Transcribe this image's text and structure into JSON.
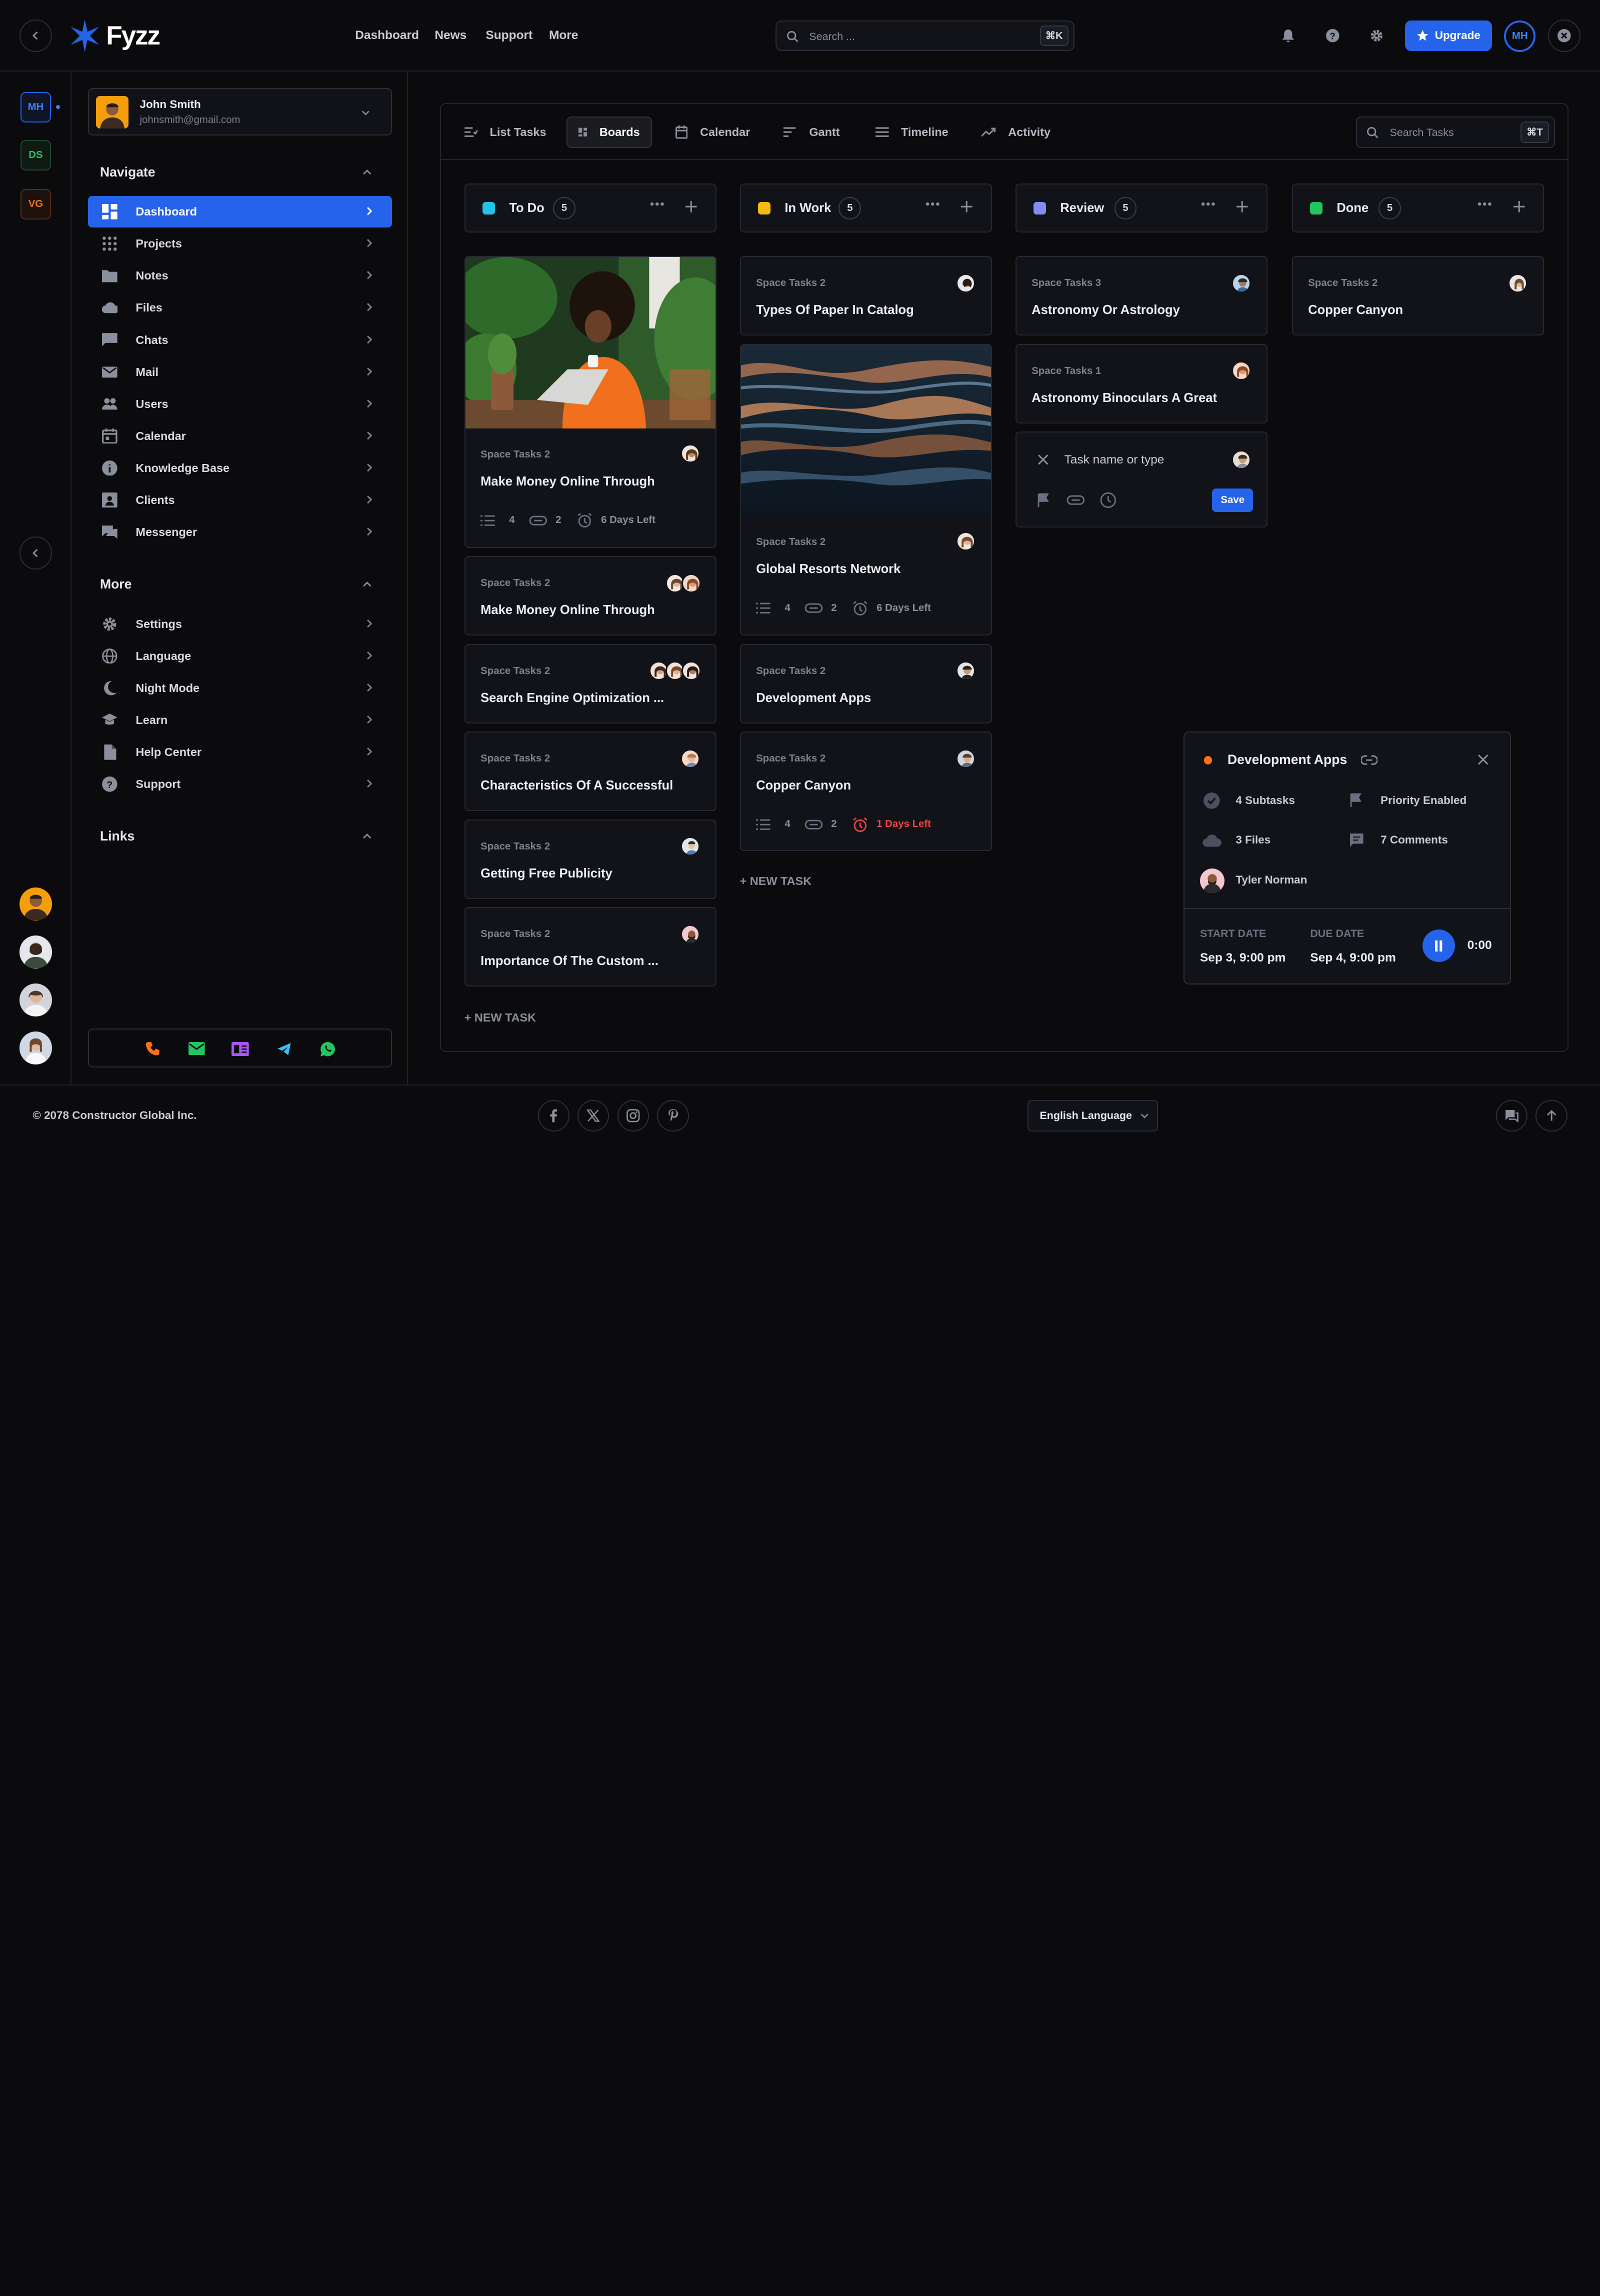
{
  "brand": {
    "name": "Fyzz"
  },
  "header": {
    "nav": [
      "Dashboard",
      "News",
      "Support",
      "More"
    ],
    "search_placeholder": "Search ...",
    "search_shortcut": "⌘K",
    "upgrade_label": "Upgrade",
    "user_initials": "MH"
  },
  "workspaces": [
    "MH",
    "DS",
    "VG"
  ],
  "profile": {
    "name": "John Smith",
    "email": "johnsmith@gmail.com"
  },
  "sidebar": {
    "navigate_title": "Navigate",
    "navigate_items": [
      "Dashboard",
      "Projects",
      "Notes",
      "Files",
      "Chats",
      "Mail",
      "Users",
      "Calendar",
      "Knowledge Base",
      "Clients",
      "Messenger"
    ],
    "more_title": "More",
    "more_items": [
      "Settings",
      "Language",
      "Night Mode",
      "Learn",
      "Help Center",
      "Support"
    ],
    "links_title": "Links"
  },
  "tabs": [
    "List Tasks",
    "Boards",
    "Calendar",
    "Gantt",
    "Timeline",
    "Activity"
  ],
  "task_search": {
    "placeholder": "Search Tasks",
    "shortcut": "⌘T"
  },
  "columns": [
    {
      "name": "To Do",
      "count": "5",
      "color": "#22c3e6"
    },
    {
      "name": "In Work",
      "count": "5",
      "color": "#f5b90f"
    },
    {
      "name": "Review",
      "count": "5",
      "color": "#818cf8"
    },
    {
      "name": "Done",
      "count": "5",
      "color": "#22c55e"
    }
  ],
  "todo": [
    {
      "space": "Space Tasks 2",
      "title": "Make Money Online Through",
      "subtasks": "4",
      "links": "2",
      "due": "6 Days Left"
    },
    {
      "space": "Space Tasks 2",
      "title": "Make Money Online Through"
    },
    {
      "space": "Space Tasks 2",
      "title": "Search Engine Optimization ..."
    },
    {
      "space": "Space Tasks 2",
      "title": "Characteristics Of A Successful"
    },
    {
      "space": "Space Tasks 2",
      "title": "Getting Free Publicity"
    },
    {
      "space": "Space Tasks 2",
      "title": "Importance Of The Custom ..."
    }
  ],
  "inwork": [
    {
      "space": "Space Tasks 2",
      "title": "Types Of Paper In Catalog"
    },
    {
      "space": "Space Tasks 2",
      "title": "Global Resorts Network",
      "subtasks": "4",
      "links": "2",
      "due": "6 Days Left"
    },
    {
      "space": "Space Tasks 2",
      "title": "Development Apps"
    },
    {
      "space": "Space Tasks 2",
      "title": "Copper Canyon",
      "subtasks": "4",
      "links": "2",
      "due": "1 Days Left"
    }
  ],
  "review": [
    {
      "space": "Space Tasks 3",
      "title": "Astronomy Or Astrology"
    },
    {
      "space": "Space Tasks 1",
      "title": "Astronomy Binoculars A Great"
    }
  ],
  "review_new": {
    "placeholder": "Task name or type",
    "save": "Save"
  },
  "done": [
    {
      "space": "Space Tasks 2",
      "title": "Copper Canyon"
    }
  ],
  "new_task_label": "+ NEW TASK",
  "popup": {
    "title": "Development Apps",
    "subtasks": "4 Subtasks",
    "priority": "Priority Enabled",
    "files": "3 Files",
    "comments": "7 Comments",
    "assignee": "Tyler Norman",
    "start_label": "START DATE",
    "start_value": "Sep 3, 9:00 pm",
    "due_label": "DUE DATE",
    "due_value": "Sep 4, 9:00 pm",
    "timer": "0:00"
  },
  "footer": {
    "copyright": "© 2078 Constructor Global Inc.",
    "language": "English Language"
  },
  "colors": {
    "accent": "#2563eb",
    "danger": "#ef4444",
    "popup_dot": "#f97316"
  }
}
